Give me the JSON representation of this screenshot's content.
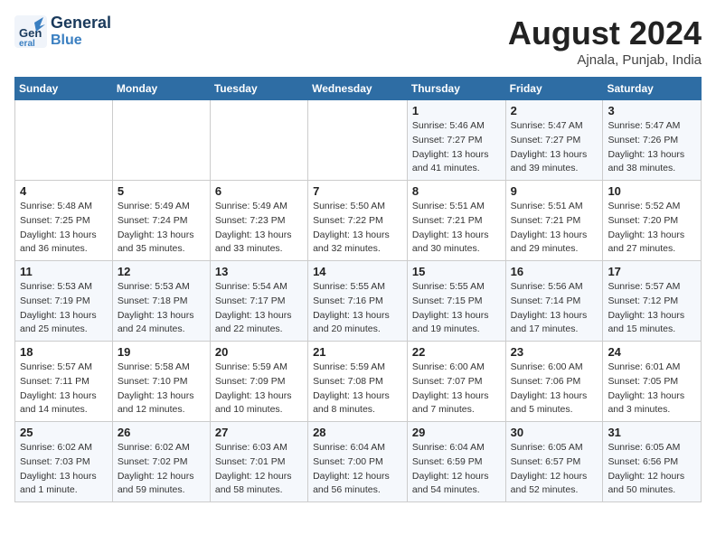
{
  "header": {
    "logo_line1": "General",
    "logo_line2": "Blue",
    "month": "August 2024",
    "location": "Ajnala, Punjab, India"
  },
  "weekdays": [
    "Sunday",
    "Monday",
    "Tuesday",
    "Wednesday",
    "Thursday",
    "Friday",
    "Saturday"
  ],
  "weeks": [
    [
      {
        "day": "",
        "data": ""
      },
      {
        "day": "",
        "data": ""
      },
      {
        "day": "",
        "data": ""
      },
      {
        "day": "",
        "data": ""
      },
      {
        "day": "1",
        "data": "Sunrise: 5:46 AM\nSunset: 7:27 PM\nDaylight: 13 hours\nand 41 minutes."
      },
      {
        "day": "2",
        "data": "Sunrise: 5:47 AM\nSunset: 7:27 PM\nDaylight: 13 hours\nand 39 minutes."
      },
      {
        "day": "3",
        "data": "Sunrise: 5:47 AM\nSunset: 7:26 PM\nDaylight: 13 hours\nand 38 minutes."
      }
    ],
    [
      {
        "day": "4",
        "data": "Sunrise: 5:48 AM\nSunset: 7:25 PM\nDaylight: 13 hours\nand 36 minutes."
      },
      {
        "day": "5",
        "data": "Sunrise: 5:49 AM\nSunset: 7:24 PM\nDaylight: 13 hours\nand 35 minutes."
      },
      {
        "day": "6",
        "data": "Sunrise: 5:49 AM\nSunset: 7:23 PM\nDaylight: 13 hours\nand 33 minutes."
      },
      {
        "day": "7",
        "data": "Sunrise: 5:50 AM\nSunset: 7:22 PM\nDaylight: 13 hours\nand 32 minutes."
      },
      {
        "day": "8",
        "data": "Sunrise: 5:51 AM\nSunset: 7:21 PM\nDaylight: 13 hours\nand 30 minutes."
      },
      {
        "day": "9",
        "data": "Sunrise: 5:51 AM\nSunset: 7:21 PM\nDaylight: 13 hours\nand 29 minutes."
      },
      {
        "day": "10",
        "data": "Sunrise: 5:52 AM\nSunset: 7:20 PM\nDaylight: 13 hours\nand 27 minutes."
      }
    ],
    [
      {
        "day": "11",
        "data": "Sunrise: 5:53 AM\nSunset: 7:19 PM\nDaylight: 13 hours\nand 25 minutes."
      },
      {
        "day": "12",
        "data": "Sunrise: 5:53 AM\nSunset: 7:18 PM\nDaylight: 13 hours\nand 24 minutes."
      },
      {
        "day": "13",
        "data": "Sunrise: 5:54 AM\nSunset: 7:17 PM\nDaylight: 13 hours\nand 22 minutes."
      },
      {
        "day": "14",
        "data": "Sunrise: 5:55 AM\nSunset: 7:16 PM\nDaylight: 13 hours\nand 20 minutes."
      },
      {
        "day": "15",
        "data": "Sunrise: 5:55 AM\nSunset: 7:15 PM\nDaylight: 13 hours\nand 19 minutes."
      },
      {
        "day": "16",
        "data": "Sunrise: 5:56 AM\nSunset: 7:14 PM\nDaylight: 13 hours\nand 17 minutes."
      },
      {
        "day": "17",
        "data": "Sunrise: 5:57 AM\nSunset: 7:12 PM\nDaylight: 13 hours\nand 15 minutes."
      }
    ],
    [
      {
        "day": "18",
        "data": "Sunrise: 5:57 AM\nSunset: 7:11 PM\nDaylight: 13 hours\nand 14 minutes."
      },
      {
        "day": "19",
        "data": "Sunrise: 5:58 AM\nSunset: 7:10 PM\nDaylight: 13 hours\nand 12 minutes."
      },
      {
        "day": "20",
        "data": "Sunrise: 5:59 AM\nSunset: 7:09 PM\nDaylight: 13 hours\nand 10 minutes."
      },
      {
        "day": "21",
        "data": "Sunrise: 5:59 AM\nSunset: 7:08 PM\nDaylight: 13 hours\nand 8 minutes."
      },
      {
        "day": "22",
        "data": "Sunrise: 6:00 AM\nSunset: 7:07 PM\nDaylight: 13 hours\nand 7 minutes."
      },
      {
        "day": "23",
        "data": "Sunrise: 6:00 AM\nSunset: 7:06 PM\nDaylight: 13 hours\nand 5 minutes."
      },
      {
        "day": "24",
        "data": "Sunrise: 6:01 AM\nSunset: 7:05 PM\nDaylight: 13 hours\nand 3 minutes."
      }
    ],
    [
      {
        "day": "25",
        "data": "Sunrise: 6:02 AM\nSunset: 7:03 PM\nDaylight: 13 hours\nand 1 minute."
      },
      {
        "day": "26",
        "data": "Sunrise: 6:02 AM\nSunset: 7:02 PM\nDaylight: 12 hours\nand 59 minutes."
      },
      {
        "day": "27",
        "data": "Sunrise: 6:03 AM\nSunset: 7:01 PM\nDaylight: 12 hours\nand 58 minutes."
      },
      {
        "day": "28",
        "data": "Sunrise: 6:04 AM\nSunset: 7:00 PM\nDaylight: 12 hours\nand 56 minutes."
      },
      {
        "day": "29",
        "data": "Sunrise: 6:04 AM\nSunset: 6:59 PM\nDaylight: 12 hours\nand 54 minutes."
      },
      {
        "day": "30",
        "data": "Sunrise: 6:05 AM\nSunset: 6:57 PM\nDaylight: 12 hours\nand 52 minutes."
      },
      {
        "day": "31",
        "data": "Sunrise: 6:05 AM\nSunset: 6:56 PM\nDaylight: 12 hours\nand 50 minutes."
      }
    ]
  ]
}
